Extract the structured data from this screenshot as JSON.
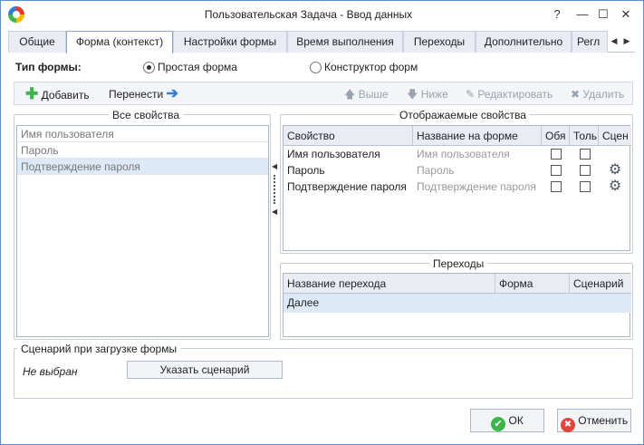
{
  "window": {
    "title": "Пользовательская Задача - Ввод данных",
    "controls": [
      "help-icon",
      "minimize-icon",
      "maximize-icon",
      "close-icon"
    ]
  },
  "tabs": [
    {
      "label": "Общие",
      "active": false
    },
    {
      "label": "Форма (контекст)",
      "active": true
    },
    {
      "label": "Настройки формы",
      "active": false
    },
    {
      "label": "Время выполнения",
      "active": false
    },
    {
      "label": "Переходы",
      "active": false
    },
    {
      "label": "Дополнительно",
      "active": false
    },
    {
      "label": "Регл",
      "active": false
    }
  ],
  "form_type": {
    "label": "Тип формы:",
    "options": [
      {
        "label": "Простая форма",
        "selected": true
      },
      {
        "label": "Конструктор форм",
        "selected": false
      }
    ]
  },
  "toolbar": {
    "add": "Добавить",
    "move": "Перенести",
    "up": "Выше",
    "down": "Ниже",
    "edit": "Редактировать",
    "delete": "Удалить"
  },
  "all_properties": {
    "title": "Все свойства",
    "items": [
      "Имя пользователя",
      "Пароль",
      "Подтверждение пароля"
    ],
    "selected_index": 2
  },
  "displayed_properties": {
    "title": "Отображаемые свойства",
    "columns": [
      "Свойство",
      "Название на форме",
      "Обя",
      "Толь",
      "Сцен"
    ],
    "rows": [
      {
        "property": "Имя пользователя",
        "form_name": "Имя пользователя",
        "required": false,
        "readonly": false,
        "scenario": false
      },
      {
        "property": "Пароль",
        "form_name": "Пароль",
        "required": false,
        "readonly": false,
        "scenario": true
      },
      {
        "property": "Подтверждение пароля",
        "form_name": "Подтверждение пароля",
        "required": false,
        "readonly": false,
        "scenario": true
      }
    ]
  },
  "transitions": {
    "title": "Переходы",
    "columns": [
      "Название перехода",
      "Форма",
      "Сценарий"
    ],
    "rows": [
      {
        "name": "Далее",
        "form": "",
        "scenario": ""
      }
    ]
  },
  "load_scenario": {
    "title": "Сценарий при загрузке формы",
    "status": "Не выбран",
    "button": "Указать сценарий"
  },
  "footer": {
    "ok": "ОК",
    "cancel": "Отменить"
  },
  "colors": {
    "accent": "#2f7fd4",
    "ok_icon": "#3cb54a",
    "cancel_icon": "#e0463c",
    "selection": "#dde9f7"
  }
}
